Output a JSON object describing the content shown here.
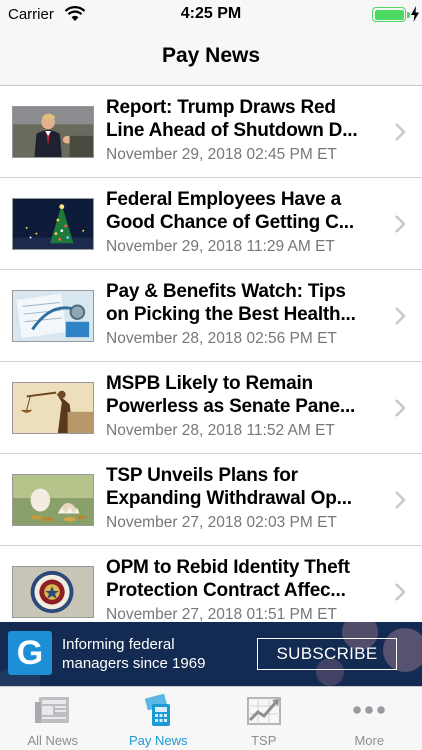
{
  "status_bar": {
    "carrier": "Carrier",
    "time": "4:25 PM",
    "battery_level": 1.0,
    "battery_color": "#4cd964"
  },
  "nav": {
    "title": "Pay News"
  },
  "articles": [
    {
      "line1": "Report: Trump Draws Red",
      "line2": "Line Ahead of Shutdown D...",
      "date": "November 29, 2018 02:45 PM ET",
      "thumbnail_icon": "speaker-at-podium-photo"
    },
    {
      "line1": "Federal Employees Have a",
      "line2": "Good Chance of Getting C...",
      "date": "November 29, 2018 11:29 AM ET",
      "thumbnail_icon": "christmas-tree-photo"
    },
    {
      "line1": "Pay & Benefits Watch: Tips",
      "line2": "on Picking the Best Health...",
      "date": "November 28, 2018 02:56 PM ET",
      "thumbnail_icon": "stethoscope-photo"
    },
    {
      "line1": "MSPB Likely to Remain",
      "line2": "Powerless as Senate Pane...",
      "date": "November 28, 2018 11:52 AM ET",
      "thumbnail_icon": "justice-statue-photo"
    },
    {
      "line1": "TSP Unveils Plans for",
      "line2": "Expanding Withdrawal Op...",
      "date": "November 27, 2018 02:03 PM ET",
      "thumbnail_icon": "nest-egg-coins-photo"
    },
    {
      "line1": "OPM to Rebid Identity Theft",
      "line2": "Protection Contract Affec...",
      "date": "November 27, 2018 01:51 PM ET",
      "thumbnail_icon": "agency-seal-photo"
    }
  ],
  "banner": {
    "logo_letter": "G",
    "tagline_line1": "Informing federal",
    "tagline_line2": "managers since 1969",
    "subscribe_label": "SUBSCRIBE",
    "accent": "#1d8fd6"
  },
  "tabs": [
    {
      "label": "All News",
      "icon": "newspaper-icon",
      "active": false
    },
    {
      "label": "Pay News",
      "icon": "money-calculator-icon",
      "active": true
    },
    {
      "label": "TSP",
      "icon": "chart-trend-icon",
      "active": false
    },
    {
      "label": "More",
      "icon": "more-dots-icon",
      "active": false
    }
  ],
  "colors": {
    "active_tab": "#1b9ad6",
    "inactive_tab": "#8e8e93"
  }
}
